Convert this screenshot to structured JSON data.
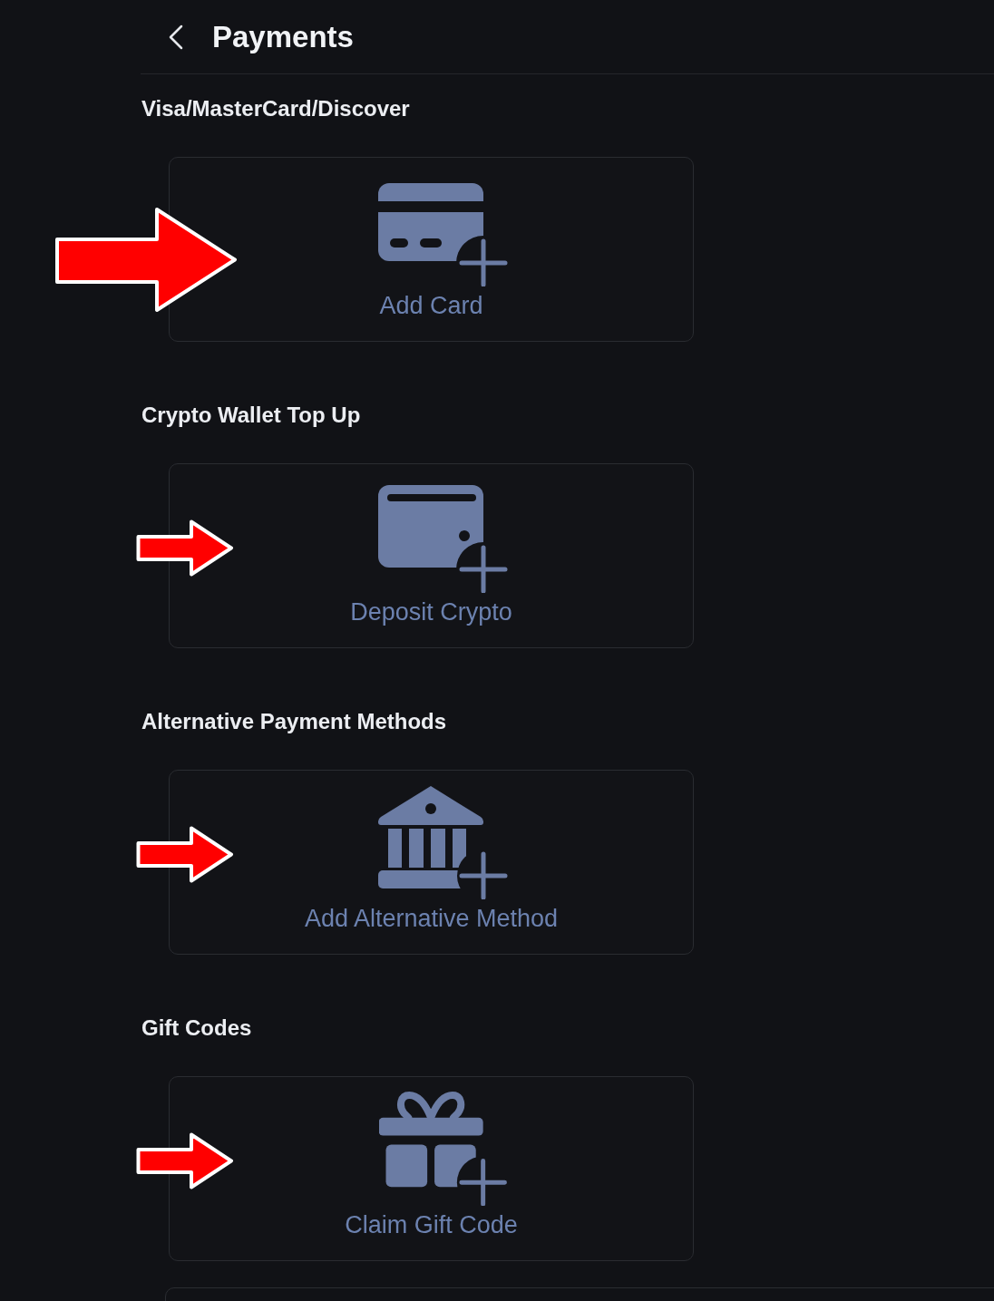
{
  "header": {
    "title": "Payments"
  },
  "sections": [
    {
      "title": "Visa/MasterCard/Discover",
      "arrow": {
        "kind": "large"
      },
      "action": {
        "kind": "card",
        "label": "Add Card"
      }
    },
    {
      "title": "Crypto Wallet Top Up",
      "arrow": {
        "kind": "small"
      },
      "action": {
        "kind": "wallet",
        "label": "Deposit Crypto"
      }
    },
    {
      "title": "Alternative Payment Methods",
      "arrow": {
        "kind": "small"
      },
      "action": {
        "kind": "bank",
        "label": "Add Alternative Method"
      }
    },
    {
      "title": "Gift Codes",
      "arrow": {
        "kind": "small"
      },
      "action": {
        "kind": "gift",
        "label": "Claim Gift Code"
      }
    }
  ]
}
